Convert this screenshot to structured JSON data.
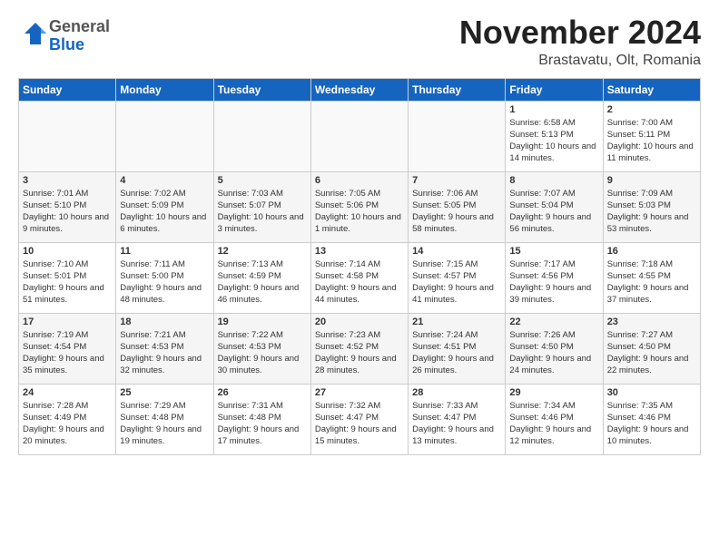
{
  "logo": {
    "general": "General",
    "blue": "Blue"
  },
  "header": {
    "title": "November 2024",
    "subtitle": "Brastavatu, Olt, Romania"
  },
  "weekdays": [
    "Sunday",
    "Monday",
    "Tuesday",
    "Wednesday",
    "Thursday",
    "Friday",
    "Saturday"
  ],
  "weeks": [
    [
      {
        "day": "",
        "info": ""
      },
      {
        "day": "",
        "info": ""
      },
      {
        "day": "",
        "info": ""
      },
      {
        "day": "",
        "info": ""
      },
      {
        "day": "",
        "info": ""
      },
      {
        "day": "1",
        "info": "Sunrise: 6:58 AM\nSunset: 5:13 PM\nDaylight: 10 hours and 14 minutes."
      },
      {
        "day": "2",
        "info": "Sunrise: 7:00 AM\nSunset: 5:11 PM\nDaylight: 10 hours and 11 minutes."
      }
    ],
    [
      {
        "day": "3",
        "info": "Sunrise: 7:01 AM\nSunset: 5:10 PM\nDaylight: 10 hours and 9 minutes."
      },
      {
        "day": "4",
        "info": "Sunrise: 7:02 AM\nSunset: 5:09 PM\nDaylight: 10 hours and 6 minutes."
      },
      {
        "day": "5",
        "info": "Sunrise: 7:03 AM\nSunset: 5:07 PM\nDaylight: 10 hours and 3 minutes."
      },
      {
        "day": "6",
        "info": "Sunrise: 7:05 AM\nSunset: 5:06 PM\nDaylight: 10 hours and 1 minute."
      },
      {
        "day": "7",
        "info": "Sunrise: 7:06 AM\nSunset: 5:05 PM\nDaylight: 9 hours and 58 minutes."
      },
      {
        "day": "8",
        "info": "Sunrise: 7:07 AM\nSunset: 5:04 PM\nDaylight: 9 hours and 56 minutes."
      },
      {
        "day": "9",
        "info": "Sunrise: 7:09 AM\nSunset: 5:03 PM\nDaylight: 9 hours and 53 minutes."
      }
    ],
    [
      {
        "day": "10",
        "info": "Sunrise: 7:10 AM\nSunset: 5:01 PM\nDaylight: 9 hours and 51 minutes."
      },
      {
        "day": "11",
        "info": "Sunrise: 7:11 AM\nSunset: 5:00 PM\nDaylight: 9 hours and 48 minutes."
      },
      {
        "day": "12",
        "info": "Sunrise: 7:13 AM\nSunset: 4:59 PM\nDaylight: 9 hours and 46 minutes."
      },
      {
        "day": "13",
        "info": "Sunrise: 7:14 AM\nSunset: 4:58 PM\nDaylight: 9 hours and 44 minutes."
      },
      {
        "day": "14",
        "info": "Sunrise: 7:15 AM\nSunset: 4:57 PM\nDaylight: 9 hours and 41 minutes."
      },
      {
        "day": "15",
        "info": "Sunrise: 7:17 AM\nSunset: 4:56 PM\nDaylight: 9 hours and 39 minutes."
      },
      {
        "day": "16",
        "info": "Sunrise: 7:18 AM\nSunset: 4:55 PM\nDaylight: 9 hours and 37 minutes."
      }
    ],
    [
      {
        "day": "17",
        "info": "Sunrise: 7:19 AM\nSunset: 4:54 PM\nDaylight: 9 hours and 35 minutes."
      },
      {
        "day": "18",
        "info": "Sunrise: 7:21 AM\nSunset: 4:53 PM\nDaylight: 9 hours and 32 minutes."
      },
      {
        "day": "19",
        "info": "Sunrise: 7:22 AM\nSunset: 4:53 PM\nDaylight: 9 hours and 30 minutes."
      },
      {
        "day": "20",
        "info": "Sunrise: 7:23 AM\nSunset: 4:52 PM\nDaylight: 9 hours and 28 minutes."
      },
      {
        "day": "21",
        "info": "Sunrise: 7:24 AM\nSunset: 4:51 PM\nDaylight: 9 hours and 26 minutes."
      },
      {
        "day": "22",
        "info": "Sunrise: 7:26 AM\nSunset: 4:50 PM\nDaylight: 9 hours and 24 minutes."
      },
      {
        "day": "23",
        "info": "Sunrise: 7:27 AM\nSunset: 4:50 PM\nDaylight: 9 hours and 22 minutes."
      }
    ],
    [
      {
        "day": "24",
        "info": "Sunrise: 7:28 AM\nSunset: 4:49 PM\nDaylight: 9 hours and 20 minutes."
      },
      {
        "day": "25",
        "info": "Sunrise: 7:29 AM\nSunset: 4:48 PM\nDaylight: 9 hours and 19 minutes."
      },
      {
        "day": "26",
        "info": "Sunrise: 7:31 AM\nSunset: 4:48 PM\nDaylight: 9 hours and 17 minutes."
      },
      {
        "day": "27",
        "info": "Sunrise: 7:32 AM\nSunset: 4:47 PM\nDaylight: 9 hours and 15 minutes."
      },
      {
        "day": "28",
        "info": "Sunrise: 7:33 AM\nSunset: 4:47 PM\nDaylight: 9 hours and 13 minutes."
      },
      {
        "day": "29",
        "info": "Sunrise: 7:34 AM\nSunset: 4:46 PM\nDaylight: 9 hours and 12 minutes."
      },
      {
        "day": "30",
        "info": "Sunrise: 7:35 AM\nSunset: 4:46 PM\nDaylight: 9 hours and 10 minutes."
      }
    ]
  ]
}
